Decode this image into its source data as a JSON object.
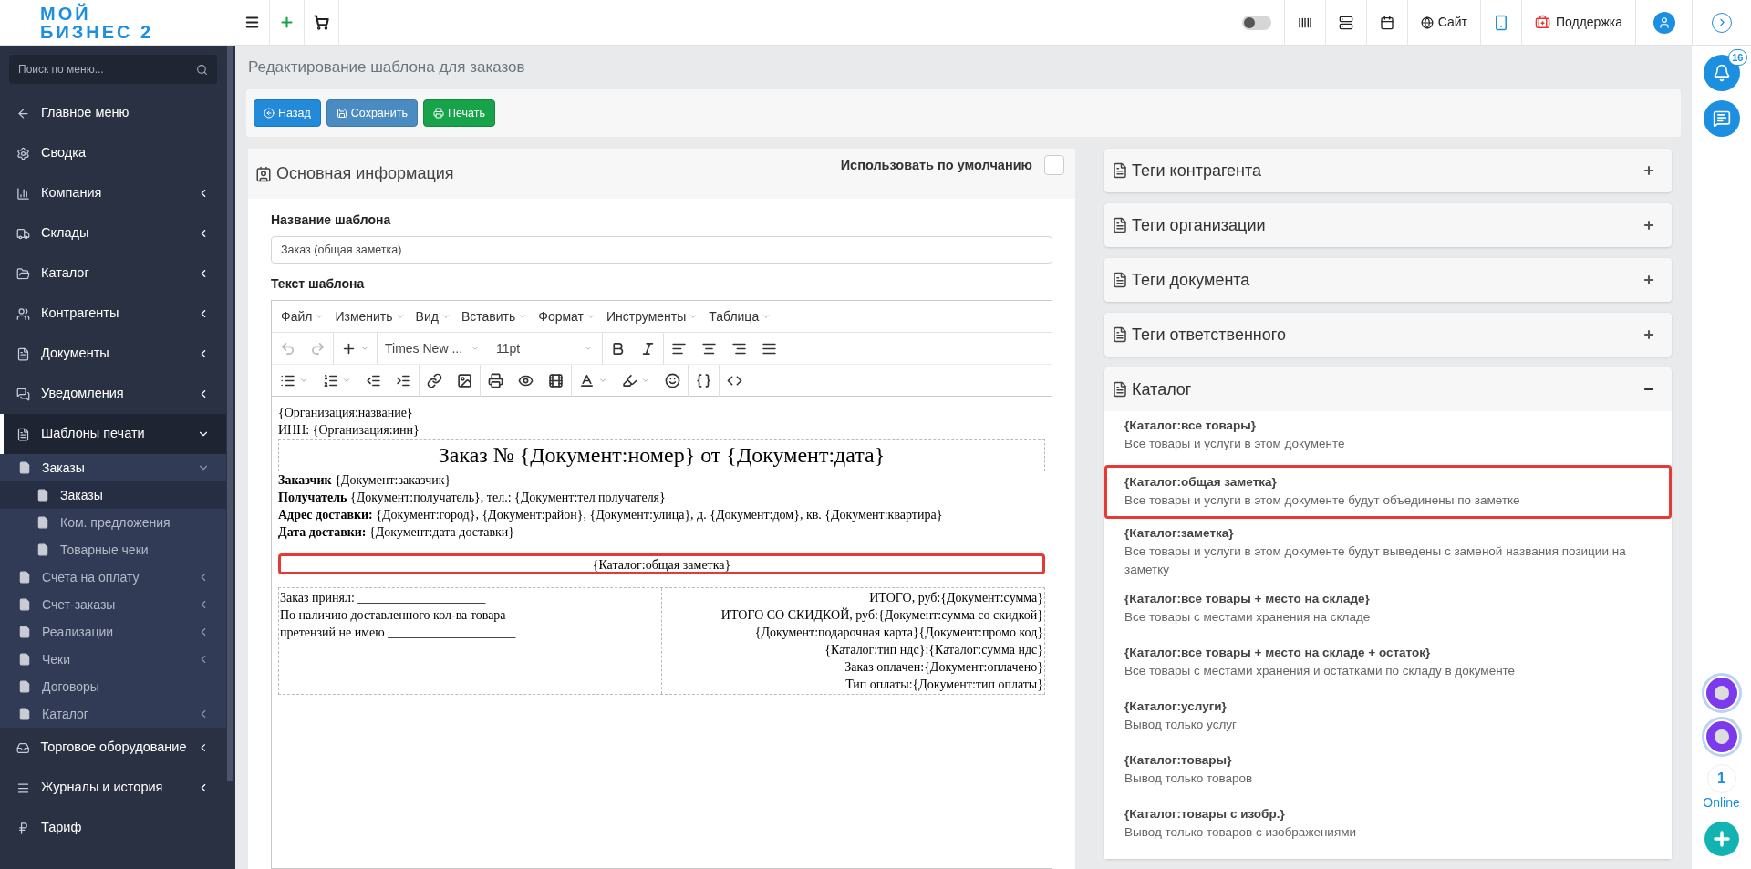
{
  "logo": {
    "line1": "МОЙ",
    "line2": "БИЗНЕС 2"
  },
  "topbar": {
    "toggle_on": false,
    "site_link": "Сайт",
    "support_link": "Поддержка"
  },
  "sidebar": {
    "search_placeholder": "Поиск по меню...",
    "items": [
      {
        "label": "Главное меню",
        "kind": "link",
        "selected": false
      },
      {
        "label": "Сводка",
        "kind": "link",
        "selected": false
      },
      {
        "label": "Компания",
        "kind": "group",
        "expanded": false,
        "selected": false
      },
      {
        "label": "Склады",
        "kind": "group",
        "expanded": false,
        "selected": false
      },
      {
        "label": "Каталог",
        "kind": "group",
        "expanded": false,
        "selected": false
      },
      {
        "label": "Контрагенты",
        "kind": "group",
        "expanded": false,
        "selected": false
      },
      {
        "label": "Документы",
        "kind": "group",
        "expanded": false,
        "selected": false
      },
      {
        "label": "Уведомления",
        "kind": "group",
        "expanded": false,
        "selected": false
      },
      {
        "label": "Шаблоны печати",
        "kind": "group",
        "expanded": true,
        "selected": true,
        "children": [
          {
            "label": "Заказы",
            "kind": "group",
            "expanded": true,
            "selected": false,
            "children": [
              {
                "label": "Заказы",
                "kind": "link",
                "selected": true
              },
              {
                "label": "Ком. предложения",
                "kind": "link",
                "selected": false
              },
              {
                "label": "Товарные чеки",
                "kind": "link",
                "selected": false
              }
            ]
          },
          {
            "label": "Счета на оплату",
            "kind": "group",
            "expanded": false,
            "selected": false
          },
          {
            "label": "Счет-заказы",
            "kind": "group",
            "expanded": false,
            "selected": false
          },
          {
            "label": "Реализации",
            "kind": "group",
            "expanded": false,
            "selected": false
          },
          {
            "label": "Чеки",
            "kind": "group",
            "expanded": false,
            "selected": false
          },
          {
            "label": "Договоры",
            "kind": "link",
            "selected": false
          },
          {
            "label": "Каталог",
            "kind": "group",
            "expanded": false,
            "selected": false
          }
        ]
      },
      {
        "label": "Торговое оборудование",
        "kind": "group",
        "expanded": false,
        "selected": false
      },
      {
        "label": "Журналы и история",
        "kind": "group",
        "expanded": false,
        "selected": false
      },
      {
        "label": "Тариф",
        "kind": "link",
        "selected": false
      }
    ]
  },
  "page_title": "Редактирование шаблона для заказов",
  "actions": [
    {
      "label": "Назад",
      "kind": "back"
    },
    {
      "label": "Сохранить",
      "kind": "save"
    },
    {
      "label": "Печать",
      "kind": "print"
    }
  ],
  "main_card": {
    "title": "Основная информация",
    "default_label": "Использовать по умолчанию",
    "default_checked": false,
    "name_label": "Название шаблона",
    "name_value": "Заказ (общая заметка)",
    "text_label": "Текст шаблона"
  },
  "editor": {
    "menu": [
      "Файл",
      "Изменить",
      "Вид",
      "Вставить",
      "Формат",
      "Инструменты",
      "Таблица"
    ],
    "toolbar": {
      "undo_disabled": true,
      "redo_disabled": true,
      "font": "Times New ...",
      "size": "11pt"
    },
    "document": {
      "top_lines": [
        "{Организация:название}",
        "ИНН: {Организация:инн}"
      ],
      "title": "Заказ № {Документ:номер} от {Документ:дата}",
      "fields": [
        {
          "label": "Заказчик",
          "value": "{Документ:заказчик}"
        },
        {
          "label": "Получатель",
          "value": "{Документ:получатель}, тел.: {Документ:тел получателя}"
        },
        {
          "label": "Адрес доставки:",
          "value": "{Документ:город}, {Документ:район}, {Документ:улица}, д. {Документ:дом}, кв. {Документ:квартира}"
        },
        {
          "label": "Дата доставки:",
          "value": "{Документ:дата доставки}"
        }
      ],
      "note_block": {
        "text": "{Каталог:общая заметка}",
        "highlighted": true
      },
      "footer_left": [
        "Заказ принял: ____________________",
        "По наличию доставленного кол-ва товара",
        "претензий не имею ____________________"
      ],
      "footer_right": [
        "ИТОГО, руб:{Документ:сумма}",
        "ИТОГО СО СКИДКОЙ, руб:{Документ:сумма со скидкой}",
        "{Документ:подарочная карта}{Документ:промо код}",
        "{Каталог:тип ндс}:{Каталог:сумма ндс}",
        "Заказ оплачен:{Документ:оплачено}",
        "Тип оплаты:{Документ:тип оплаты}"
      ]
    }
  },
  "tag_sections": [
    {
      "title": "Теги контрагента",
      "expanded": false
    },
    {
      "title": "Теги организации",
      "expanded": false
    },
    {
      "title": "Теги документа",
      "expanded": false
    },
    {
      "title": "Теги ответственного",
      "expanded": false
    },
    {
      "title": "Каталог",
      "expanded": true,
      "items": [
        {
          "tag": "{Каталог:все товары}",
          "description": "Все товары и услуги в этом документе",
          "highlighted": false
        },
        {
          "tag": "{Каталог:общая заметка}",
          "description": "Все товары и услуги в этом документе будут объединены по заметке",
          "highlighted": true
        },
        {
          "tag": "{Каталог:заметка}",
          "description": "Все товары и услуги в этом документе будут выведены с заменой названия позиции на заметку",
          "highlighted": false
        },
        {
          "tag": "{Каталог:все товары + место на складе}",
          "description": "Все товары с местами хранения на складе",
          "highlighted": false
        },
        {
          "tag": "{Каталог:все товары + место на складе + остаток}",
          "description": "Все товары с местами хранения и остатками по складу в документе",
          "highlighted": false
        },
        {
          "tag": "{Каталог:услуги}",
          "description": "Вывод только услуг",
          "highlighted": false
        },
        {
          "tag": "{Каталог:товары}",
          "description": "Вывод только товаров",
          "highlighted": false
        },
        {
          "tag": "{Каталог:товары с изобр.}",
          "description": "Вывод только товаров с изображениями",
          "highlighted": false
        }
      ]
    }
  ],
  "right_rail": {
    "notifications": "16",
    "online_count": "1",
    "online_label": "Online"
  }
}
